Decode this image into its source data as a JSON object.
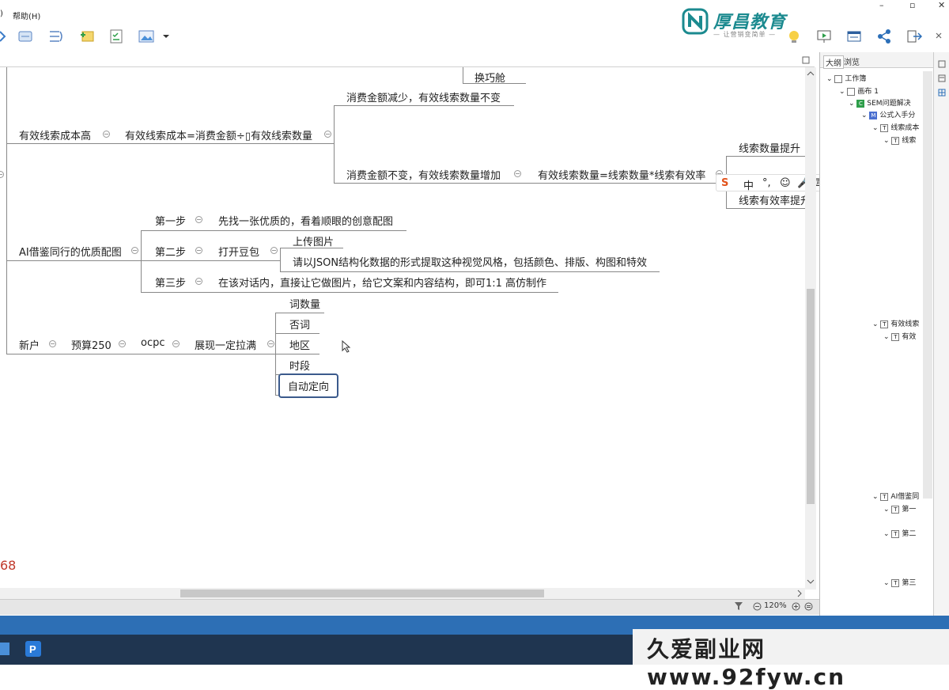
{
  "menubar": {
    "left_fragment": ")",
    "help": "帮助(H)"
  },
  "window_controls": {
    "minimize": "–",
    "restore": "▫",
    "close": "✕"
  },
  "logo": {
    "name": "厚昌教育",
    "slogan": "— 让营销变简单 —"
  },
  "toolbar": {
    "icons": [
      "branch-icon",
      "relationship-icon",
      "boundary-icon",
      "note-icon",
      "task-icon",
      "image-icon",
      "dropdown-icon",
      "idea-icon",
      "present-icon",
      "window-icon",
      "share-icon",
      "export-icon",
      "more-icon"
    ]
  },
  "mindmap": {
    "partial_top": "换巧舱",
    "cost": {
      "root": "有效线索成本高",
      "formula": "有效线索成本=消费金额÷▯有效线索数量",
      "branch_a": "消费金额减少，有效线索数量不变",
      "branch_b": "消费金额不变，有效线索数量增加",
      "formula2": "有效线索数量=线索数量*线索有效率",
      "leaf1": "线索数量提升",
      "leaf2": "线索有效率提升"
    },
    "ai": {
      "root": "AI借鉴同行的优质配图",
      "step1": "第一步",
      "step1_text": "先找一张优质的，看着顺眼的创意配图",
      "step2": "第二步",
      "step2_text": "打开豆包",
      "step2_sub1": "上传图片",
      "step2_sub2": "请以JSON结构化数据的形式提取这种视觉风格，包括颜色、排版、构图和特效",
      "step3": "第三步",
      "step3_text": "在该对话内，直接让它做图片，给它文案和内容结构，即可1:1 高仿制作"
    },
    "newuser": {
      "root": "新户",
      "budget": "预算250",
      "ocpc": "ocpc",
      "show": "展现一定拉满",
      "items": [
        "词数量",
        "否词",
        "地区",
        "时段",
        "自动定向"
      ]
    },
    "bottom_number": "68"
  },
  "status": {
    "zoom": "120%"
  },
  "panel": {
    "tabs": [
      "大纲",
      "浏览"
    ],
    "rows": [
      "工作簿",
      "画布 1",
      "SEM问题解决",
      "公式入手分",
      "线索成本",
      "线索",
      "有效线索",
      "有效",
      "AI借鉴同",
      "第一",
      "第二",
      "第三"
    ]
  },
  "ime": {
    "items": [
      "S",
      "中",
      "°,",
      "☺",
      "🎤",
      "⌨",
      "✦",
      "▦",
      "✎"
    ]
  },
  "watermark": {
    "text": "久爱副业网 www.92fyw.cn"
  },
  "colors": {
    "accent": "#1b8a8f",
    "selected_border": "#3b5a8c",
    "bottom_number": "#c0392b",
    "taskbar": "#1f3550"
  }
}
